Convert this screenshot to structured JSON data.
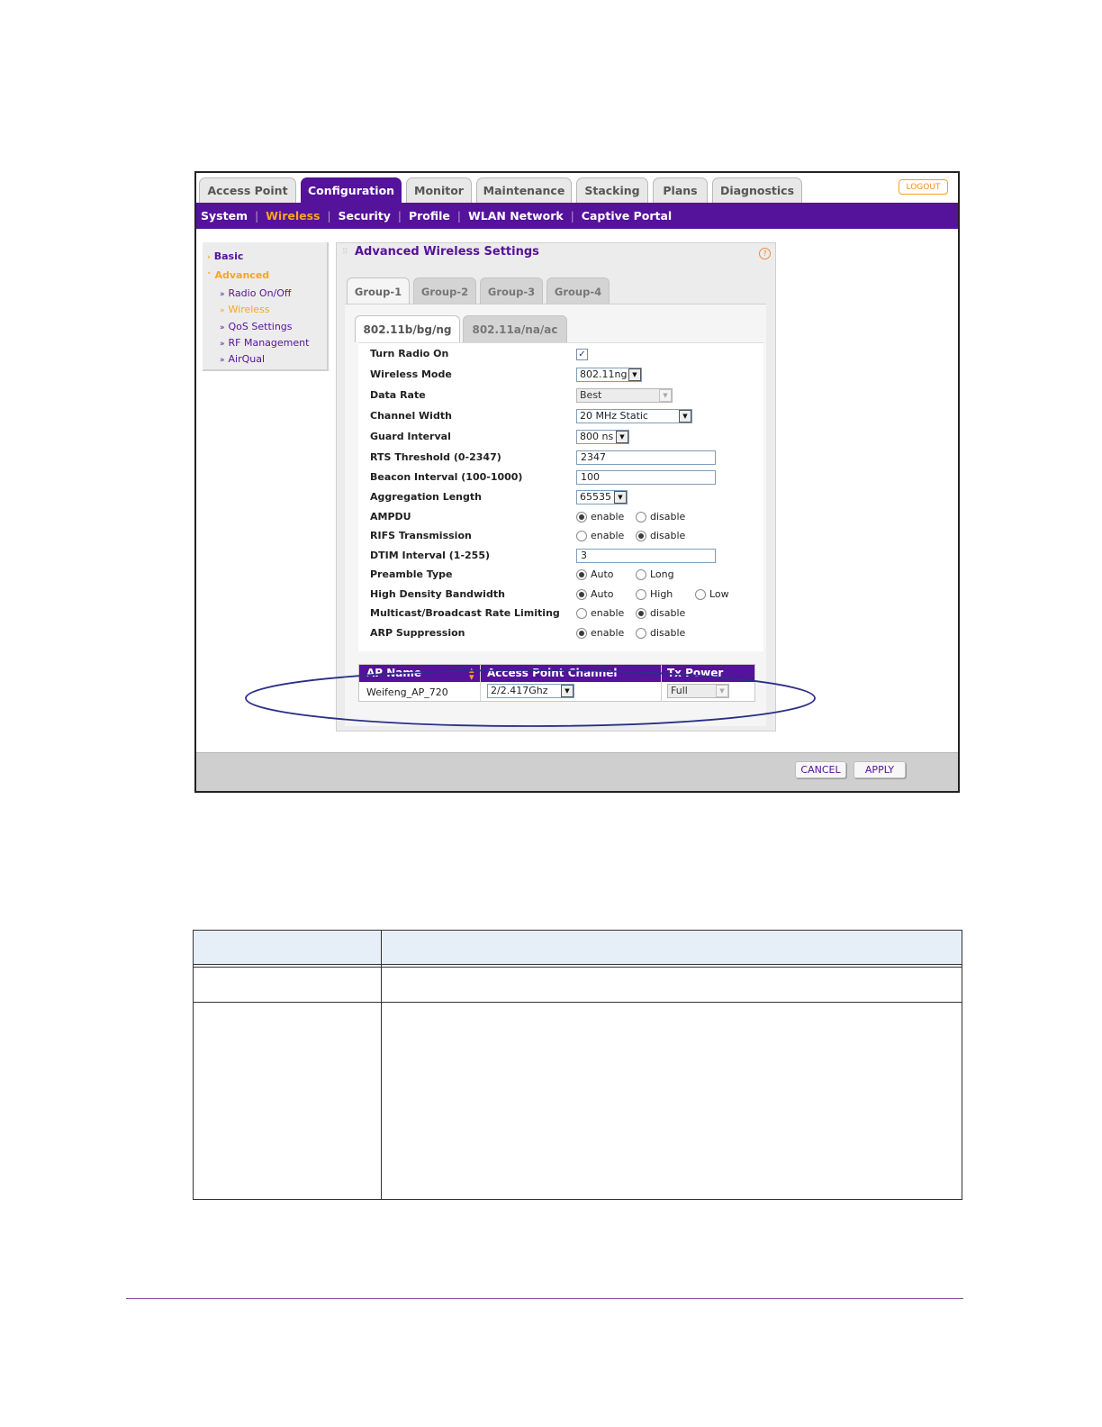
{
  "top_tabs": [
    "Access Point",
    "Configuration",
    "Monitor",
    "Maintenance",
    "Stacking",
    "Plans",
    "Diagnostics"
  ],
  "active_top_tab": "Configuration",
  "logout_label": "LOGOUT",
  "subnav": [
    "System",
    "Wireless",
    "Security",
    "Profile",
    "WLAN Network",
    "Captive Portal"
  ],
  "active_subnav": "Wireless",
  "left_menu": {
    "basic": "Basic",
    "advanced": "Advanced",
    "items": [
      "Radio On/Off",
      "Wireless",
      "QoS Settings",
      "RF Management",
      "AirQual"
    ],
    "active_item": "Wireless"
  },
  "panel": {
    "title": "Advanced Wireless Settings",
    "help": "?",
    "group_tabs": [
      "Group-1",
      "Group-2",
      "Group-3",
      "Group-4"
    ],
    "radio_tabs": [
      "802.11b/bg/ng",
      "802.11a/na/ac"
    ]
  },
  "form": {
    "turn_radio_on": {
      "label": "Turn Radio On",
      "checked": true
    },
    "wireless_mode": {
      "label": "Wireless Mode",
      "value": "802.11ng"
    },
    "data_rate": {
      "label": "Data Rate",
      "value": "Best"
    },
    "channel_width": {
      "label": "Channel Width",
      "value": "20 MHz Static"
    },
    "guard_interval": {
      "label": "Guard Interval",
      "value": "800 ns"
    },
    "rts_threshold": {
      "label": "RTS Threshold (0-2347)",
      "value": "2347"
    },
    "beacon_interval": {
      "label": "Beacon Interval (100-1000)",
      "value": "100"
    },
    "aggregation_length": {
      "label": "Aggregation Length",
      "value": "65535"
    },
    "ampdu": {
      "label": "AMPDU",
      "options": [
        "enable",
        "disable"
      ],
      "selected": "enable"
    },
    "rifs": {
      "label": "RIFS Transmission",
      "options": [
        "enable",
        "disable"
      ],
      "selected": "disable"
    },
    "dtim": {
      "label": "DTIM Interval (1-255)",
      "value": "3"
    },
    "preamble": {
      "label": "Preamble Type",
      "options": [
        "Auto",
        "Long"
      ],
      "selected": "Auto"
    },
    "hd_bandwidth": {
      "label": "High Density Bandwidth",
      "options": [
        "Auto",
        "High",
        "Low"
      ],
      "selected": "Auto"
    },
    "mcast_limit": {
      "label": "Multicast/Broadcast Rate Limiting",
      "options": [
        "enable",
        "disable"
      ],
      "selected": "disable"
    },
    "arp": {
      "label": "ARP Suppression",
      "options": [
        "enable",
        "disable"
      ],
      "selected": "enable"
    }
  },
  "ap_table": {
    "headers": [
      "AP Name",
      "Access Point Channel",
      "Tx Power"
    ],
    "row": {
      "ap_name": "Weifeng_AP_720",
      "channel": "2/2.417Ghz",
      "tx_power": "Full"
    }
  },
  "buttons": {
    "cancel": "CANCEL",
    "apply": "APPLY"
  },
  "colors": {
    "brand_purple": "#55129a",
    "accent_orange": "#f5a623",
    "annotation_ellipse": "#2b2f86"
  }
}
